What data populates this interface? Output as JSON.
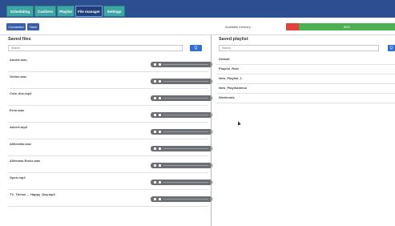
{
  "tabs": [
    {
      "label": "Scheduling",
      "active": false
    },
    {
      "label": "Cashiers",
      "active": false
    },
    {
      "label": "Playlist",
      "active": false
    },
    {
      "label": "File manager",
      "active": true
    },
    {
      "label": "Settings",
      "active": false
    }
  ],
  "toolbar": {
    "button1": "Connected",
    "button2": "Save",
    "memory_label": "Available memory",
    "memory_value": "85%",
    "memory_used_fraction": 0.12,
    "memory_free_fraction": 0.88
  },
  "saved_files": {
    "title": "Saved files",
    "search_placeholder": "Search",
    "search_button": "Q",
    "files": [
      "Adorte.wav",
      "Online.wav",
      "Cola_doc.mp3",
      "Error.wav",
      "Advert.mp3",
      "Alliteratio.wav",
      "Alliterato-Rosie.wav",
      "Open.mp3",
      "TV_Theme_-_Happy_Day.mp3"
    ]
  },
  "saved_playlist": {
    "title": "Saved playlist",
    "search_placeholder": "Search",
    "search_button": "Q",
    "playlists": [
      "Default",
      "Playlist_Real",
      "New_Playlist_1",
      "New_Playlistdemo",
      "Weekends"
    ]
  },
  "colors": {
    "topbar": "#2b4f91",
    "tab": "#3fa6a6",
    "accent": "#2f6fd1",
    "memory_used": "#e0413a",
    "memory_free": "#4caf50"
  }
}
